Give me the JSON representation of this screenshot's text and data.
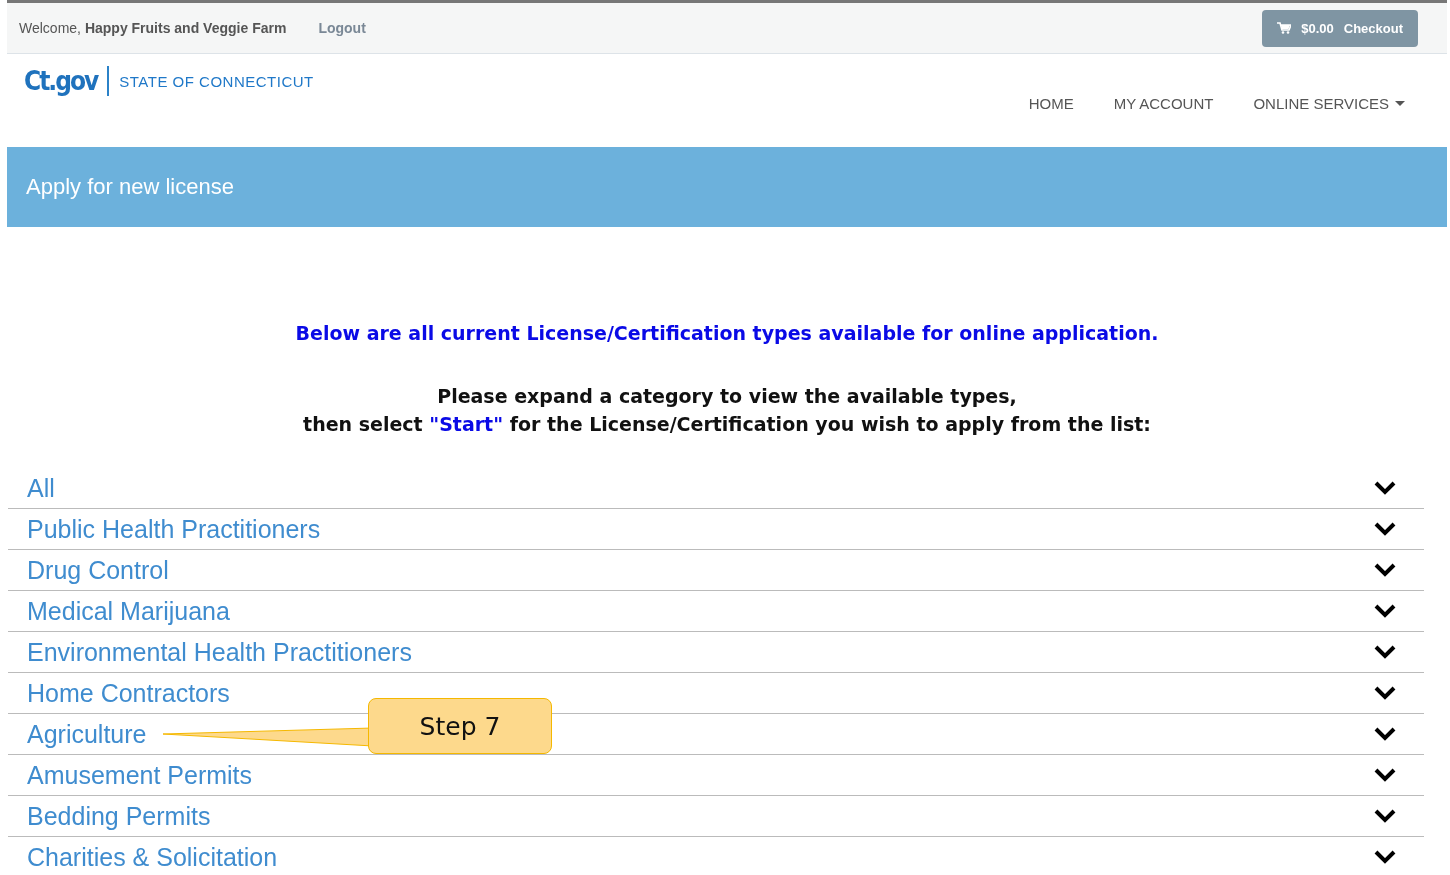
{
  "top_bar": {
    "welcome": "Welcome,",
    "user": "Happy Fruits and Veggie Farm",
    "logout": "Logout",
    "cart_total": "$0.00",
    "checkout": "Checkout"
  },
  "header": {
    "logo_text": "Ct.gov",
    "state": "STATE OF CONNECTICUT",
    "nav": [
      {
        "label": "HOME",
        "dropdown": false
      },
      {
        "label": "MY ACCOUNT",
        "dropdown": false
      },
      {
        "label": "ONLINE SERVICES",
        "dropdown": true
      }
    ]
  },
  "banner": {
    "title": "Apply for new license"
  },
  "intro": {
    "heading": "Below are all current License/Certification types available for online application.",
    "line1": "Please expand a category to view the available types,",
    "line2_before": "then select ",
    "line2_highlight": "\"Start\"",
    "line2_after": " for the License/Certification you wish to apply from the list:"
  },
  "categories": [
    {
      "label": "All",
      "expanded": false
    },
    {
      "label": "Public Health Practitioners",
      "expanded": false
    },
    {
      "label": "Drug Control",
      "expanded": false
    },
    {
      "label": "Medical Marijuana",
      "expanded": false
    },
    {
      "label": "Environmental Health Practitioners",
      "expanded": false
    },
    {
      "label": "Home Contractors",
      "expanded": false
    },
    {
      "label": "Agriculture",
      "expanded": false,
      "callout": "Step 7"
    },
    {
      "label": "Amusement Permits",
      "expanded": false
    },
    {
      "label": "Bedding Permits",
      "expanded": false
    },
    {
      "label": "Charities & Solicitation",
      "expanded": false
    }
  ]
}
